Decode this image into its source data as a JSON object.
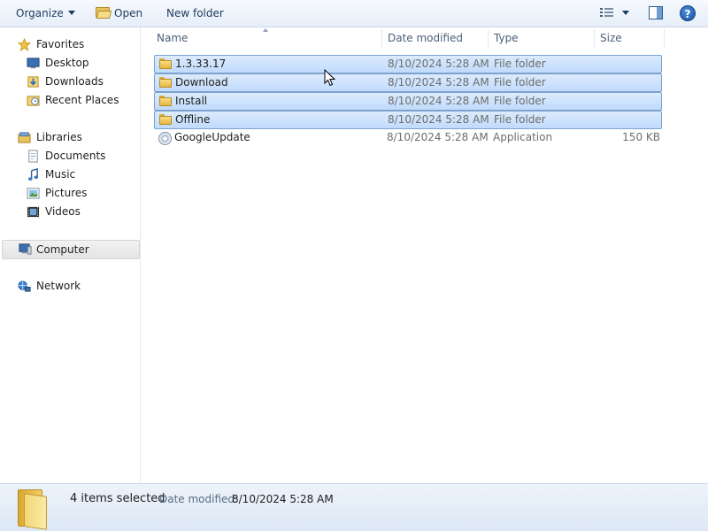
{
  "toolbar": {
    "organize_label": "Organize",
    "open_label": "Open",
    "new_folder_label": "New folder",
    "help_label": "?",
    "icons": [
      "views-icon",
      "preview-pane-icon",
      "help-icon"
    ]
  },
  "nav": {
    "favorites": {
      "label": "Favorites",
      "items": [
        {
          "label": "Desktop",
          "icon": "desktop-icon"
        },
        {
          "label": "Downloads",
          "icon": "downloads-icon"
        },
        {
          "label": "Recent Places",
          "icon": "recent-places-icon"
        }
      ]
    },
    "libraries": {
      "label": "Libraries",
      "items": [
        {
          "label": "Documents",
          "icon": "documents-icon"
        },
        {
          "label": "Music",
          "icon": "music-icon"
        },
        {
          "label": "Pictures",
          "icon": "pictures-icon"
        },
        {
          "label": "Videos",
          "icon": "videos-icon"
        }
      ]
    },
    "computer_label": "Computer",
    "network_label": "Network"
  },
  "columns": {
    "name": "Name",
    "date": "Date modified",
    "type": "Type",
    "size": "Size"
  },
  "files": [
    {
      "name": "1.3.33.17",
      "date": "8/10/2024 5:28 AM",
      "type": "File folder",
      "size": "",
      "selected": true,
      "icon": "folder-icon"
    },
    {
      "name": "Download",
      "date": "8/10/2024 5:28 AM",
      "type": "File folder",
      "size": "",
      "selected": true,
      "icon": "folder-icon"
    },
    {
      "name": "Install",
      "date": "8/10/2024 5:28 AM",
      "type": "File folder",
      "size": "",
      "selected": true,
      "icon": "folder-icon"
    },
    {
      "name": "Offline",
      "date": "8/10/2024 5:28 AM",
      "type": "File folder",
      "size": "",
      "selected": true,
      "icon": "folder-icon"
    },
    {
      "name": "GoogleUpdate",
      "date": "8/10/2024 5:28 AM",
      "type": "Application",
      "size": "150 KB",
      "selected": false,
      "icon": "application-icon"
    }
  ],
  "status": {
    "selection_count": "4 items selected",
    "date_label": "Date modified:",
    "date_value": "8/10/2024 5:28 AM"
  },
  "colors": {
    "selection_fill": "#cde3fc",
    "selection_border": "#7da2ce",
    "toolbar_text": "#1e3a5f",
    "header_text": "#4c607a"
  }
}
